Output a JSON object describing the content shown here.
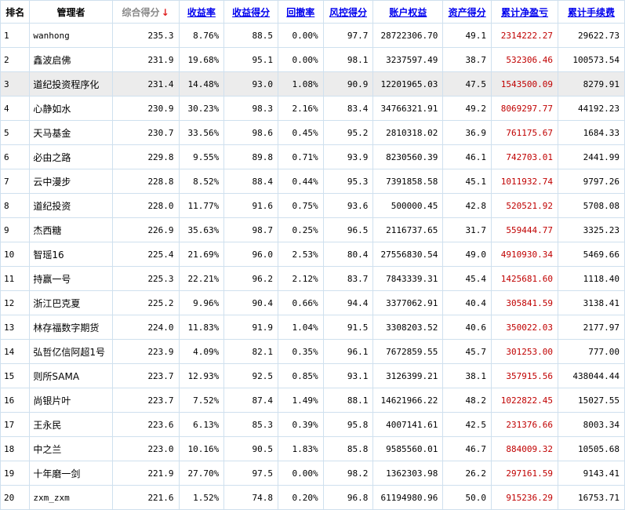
{
  "headers": [
    {
      "label": "排名",
      "link": false,
      "sorted": false
    },
    {
      "label": "管理者",
      "link": false,
      "sorted": false
    },
    {
      "label": "综合得分",
      "link": false,
      "sorted": true
    },
    {
      "label": "收益率",
      "link": true,
      "sorted": false
    },
    {
      "label": "收益得分",
      "link": true,
      "sorted": false
    },
    {
      "label": "回撤率",
      "link": true,
      "sorted": false
    },
    {
      "label": "风控得分",
      "link": true,
      "sorted": false
    },
    {
      "label": "账户权益",
      "link": true,
      "sorted": false
    },
    {
      "label": "资产得分",
      "link": true,
      "sorted": false
    },
    {
      "label": "累计净盈亏",
      "link": true,
      "sorted": false
    },
    {
      "label": "累计手续费",
      "link": true,
      "sorted": false
    }
  ],
  "sort_arrow": "↓",
  "highlight_row": 3,
  "rows": [
    [
      "1",
      "wanhong",
      "235.3",
      "8.76%",
      "88.5",
      "0.00%",
      "97.7",
      "28722306.70",
      "49.1",
      "2314222.27",
      "29622.73"
    ],
    [
      "2",
      "鑫波启佛",
      "231.9",
      "19.68%",
      "95.1",
      "0.00%",
      "98.1",
      "3237597.49",
      "38.7",
      "532306.46",
      "100573.54"
    ],
    [
      "3",
      "道纪投资程序化",
      "231.4",
      "14.48%",
      "93.0",
      "1.08%",
      "90.9",
      "12201965.03",
      "47.5",
      "1543500.09",
      "8279.91"
    ],
    [
      "4",
      "心静如水",
      "230.9",
      "30.23%",
      "98.3",
      "2.16%",
      "83.4",
      "34766321.91",
      "49.2",
      "8069297.77",
      "44192.23"
    ],
    [
      "5",
      "天马基金",
      "230.7",
      "33.56%",
      "98.6",
      "0.45%",
      "95.2",
      "2810318.02",
      "36.9",
      "761175.67",
      "1684.33"
    ],
    [
      "6",
      "必由之路",
      "229.8",
      "9.55%",
      "89.8",
      "0.71%",
      "93.9",
      "8230560.39",
      "46.1",
      "742703.01",
      "2441.99"
    ],
    [
      "7",
      "云中漫步",
      "228.8",
      "8.52%",
      "88.4",
      "0.44%",
      "95.3",
      "7391858.58",
      "45.1",
      "1011932.74",
      "9797.26"
    ],
    [
      "8",
      "道纪投资",
      "228.0",
      "11.77%",
      "91.6",
      "0.75%",
      "93.6",
      "500000.45",
      "42.8",
      "520521.92",
      "5708.08"
    ],
    [
      "9",
      "杰西糖",
      "226.9",
      "35.63%",
      "98.7",
      "0.25%",
      "96.5",
      "2116737.65",
      "31.7",
      "559444.77",
      "3325.23"
    ],
    [
      "10",
      "智瑶16",
      "225.4",
      "21.69%",
      "96.0",
      "2.53%",
      "80.4",
      "27556830.54",
      "49.0",
      "4910930.34",
      "5469.66"
    ],
    [
      "11",
      "持赢一号",
      "225.3",
      "22.21%",
      "96.2",
      "2.12%",
      "83.7",
      "7843339.31",
      "45.4",
      "1425681.60",
      "1118.40"
    ],
    [
      "12",
      "浙江巴克夏",
      "225.2",
      "9.96%",
      "90.4",
      "0.66%",
      "94.4",
      "3377062.91",
      "40.4",
      "305841.59",
      "3138.41"
    ],
    [
      "13",
      "林存福数字期货",
      "224.0",
      "11.83%",
      "91.9",
      "1.04%",
      "91.5",
      "3308203.52",
      "40.6",
      "350022.03",
      "2177.97"
    ],
    [
      "14",
      "弘哲亿信阿超1号",
      "223.9",
      "4.09%",
      "82.1",
      "0.35%",
      "96.1",
      "7672859.55",
      "45.7",
      "301253.00",
      "777.00"
    ],
    [
      "15",
      "则所SAMA",
      "223.7",
      "12.93%",
      "92.5",
      "0.85%",
      "93.1",
      "3126399.21",
      "38.1",
      "357915.56",
      "438044.44"
    ],
    [
      "16",
      "尚银片叶",
      "223.7",
      "7.52%",
      "87.4",
      "1.49%",
      "88.1",
      "14621966.22",
      "48.2",
      "1022822.45",
      "15027.55"
    ],
    [
      "17",
      "王永民",
      "223.6",
      "6.13%",
      "85.3",
      "0.39%",
      "95.8",
      "4007141.61",
      "42.5",
      "231376.66",
      "8003.34"
    ],
    [
      "18",
      "中之兰",
      "223.0",
      "10.16%",
      "90.5",
      "1.83%",
      "85.8",
      "9585560.01",
      "46.7",
      "884009.32",
      "10505.68"
    ],
    [
      "19",
      "十年磨一剑",
      "221.9",
      "27.70%",
      "97.5",
      "0.00%",
      "98.2",
      "1362303.98",
      "26.2",
      "297161.59",
      "9143.41"
    ],
    [
      "20",
      "zxm_zxm",
      "221.6",
      "1.52%",
      "74.8",
      "0.20%",
      "96.8",
      "61194980.96",
      "50.0",
      "915236.29",
      "16753.71"
    ]
  ]
}
